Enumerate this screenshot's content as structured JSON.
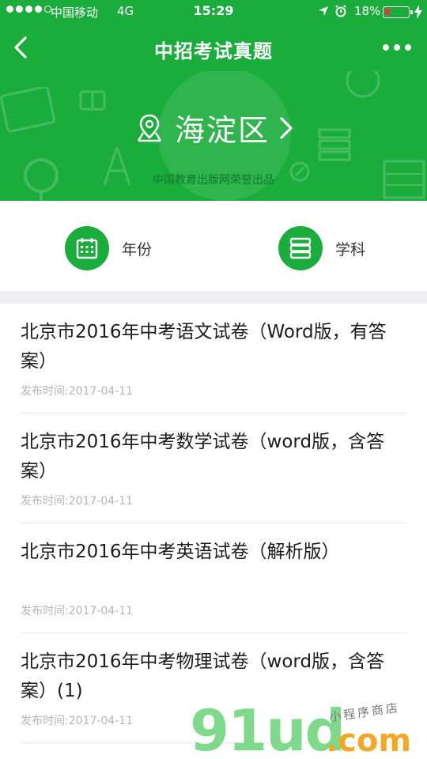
{
  "status_bar": {
    "carrier": "中国移动",
    "network": "4G",
    "time": "15:29",
    "battery": "18%"
  },
  "nav": {
    "title": "中招考试真题"
  },
  "banner": {
    "district": "海淀区",
    "publisher": "中国教育出版网荣誉出品"
  },
  "filters": {
    "year_label": "年份",
    "subject_label": "学科"
  },
  "list": [
    {
      "title": "北京市2016年中考语文试卷（Word版，有答案）",
      "date": "发布时间:2017-04-11"
    },
    {
      "title": "北京市2016年中考数学试卷（word版，含答案）",
      "date": "发布时间:2017-04-11"
    },
    {
      "title": "北京市2016年中考英语试卷（解析版）",
      "date": "发布时间:2017-04-11"
    },
    {
      "title": "北京市2016年中考物理试卷（word版，含答案）(1)",
      "date": "发布时间:2017-04-11"
    }
  ],
  "watermark": {
    "brand": "91ud",
    "domain": ".com",
    "tagline": "小程序商店"
  },
  "colors": {
    "brand_green": "#1aad3c",
    "battery_low": "#e23a3a"
  }
}
